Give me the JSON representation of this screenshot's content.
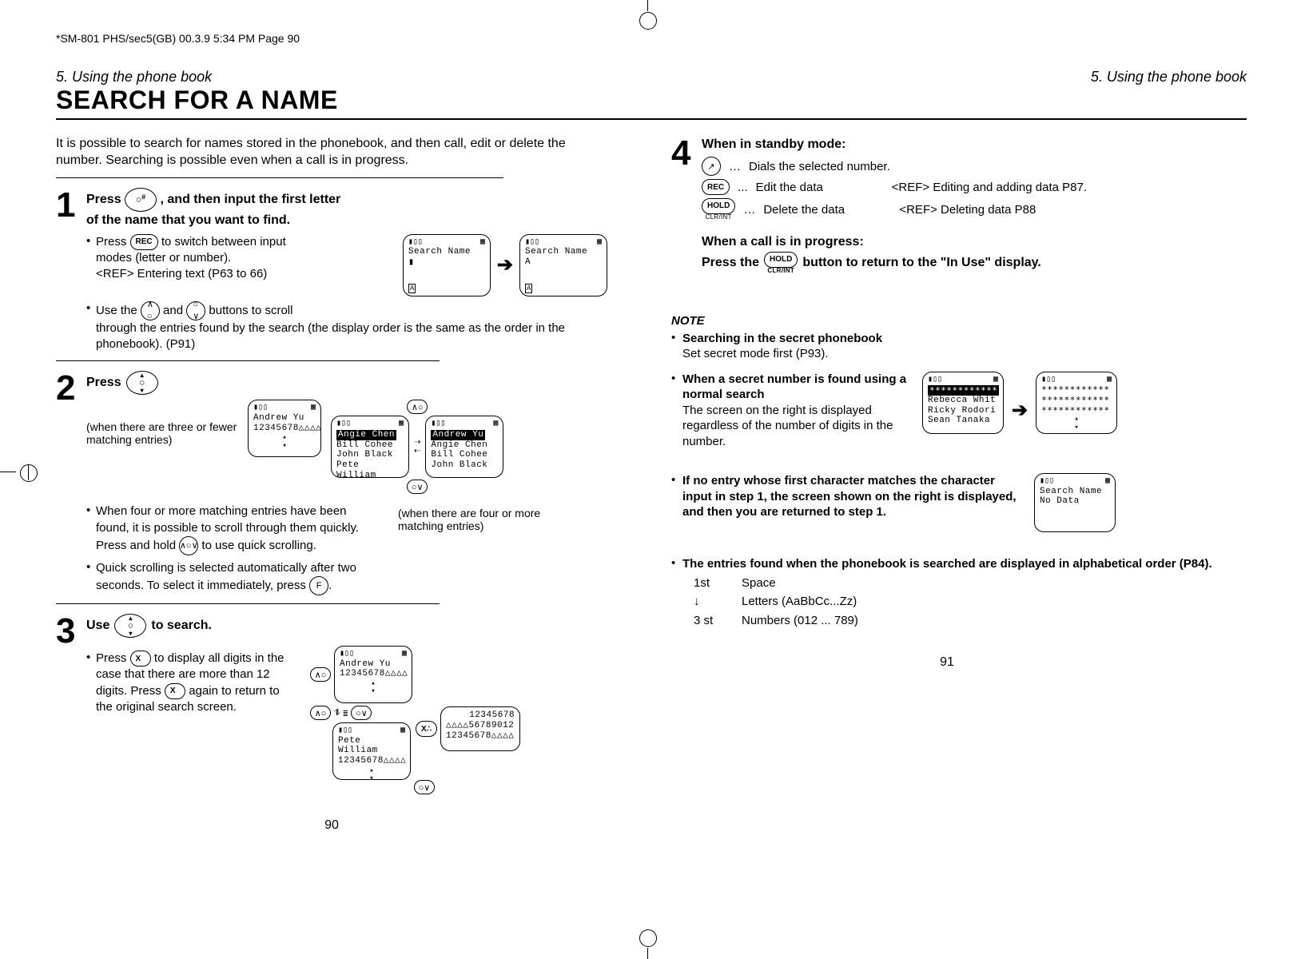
{
  "header_line": "*SM-801 PHS/sec5(GB)  00.3.9 5:34 PM  Page 90",
  "left": {
    "section": "5. Using the phone book",
    "title": "SEARCH FOR A NAME",
    "intro": "It is possible to search for names stored in the phonebook, and then call, edit or delete the number. Searching is possible even when a call is in progress.",
    "step1": {
      "lead1": "Press",
      "lead2": ", and then input the first letter",
      "lead3": "of the name that you want to find.",
      "b1a": "Press",
      "b1b": "to switch between input",
      "b1c": "modes (letter or number).",
      "ref1": "<REF> Entering text (P63 to 66)",
      "b2a": "Use the",
      "b2b": "and",
      "b2c": "buttons to scroll",
      "b2d": "through the entries found by the search (the display order is the same as the order in the phonebook). (P91)",
      "screen1_title": "Search Name",
      "screen1_mode": "A",
      "screen2_title": "Search Name",
      "screen2_line": "A",
      "screen2_mode": "A"
    },
    "step2": {
      "lead": "Press",
      "sub1": "(when there are three or fewer matching entries)",
      "screen_a_l1": "Andrew Yu",
      "screen_a_l2": "12345678△△△△",
      "list_l1": "Angie Chen",
      "list_l2": "Bill Cohee",
      "list_l3": "John Black",
      "list_l4": "Pete William",
      "list2_l1": "Andrew Yu",
      "list2_l2": "Angie Chen",
      "list2_l3": "Bill Cohee",
      "list2_l4": "John Black",
      "sub2": "(when there are four or more matching entries)",
      "b1": "When four or more matching entries have been found, it is possible to scroll through them quickly.",
      "b1a": "Press and hold",
      "b1b": "to use quick scrolling.",
      "b2": "Quick scrolling is selected automatically after two seconds. To select it immediately, press",
      "b2_end": "."
    },
    "step3": {
      "lead1": "Use",
      "lead2": "to search.",
      "b1a": "Press",
      "b1b": "to display all digits in the case that there are more than 12 digits. Press",
      "b1c": "again to return to the original search screen.",
      "screen_a_l1": "Andrew Yu",
      "screen_a_l2": "12345678△△△△",
      "screen_b_l1": "Pete William",
      "screen_b_l2": "12345678△△△△",
      "ext_l1": "12345678",
      "ext_l2": "△△△△56789012",
      "ext_l3": "12345678△△△△"
    },
    "pagenum": "90"
  },
  "right": {
    "section": "5. Using the phone book",
    "step4": {
      "head": "When in standby mode:",
      "row1": "Dials the selected number.",
      "row2a": "Edit the data",
      "row2b": "<REF> Editing and adding data P87.",
      "row3a": "Delete the data",
      "row3b": "<REF> Deleting data P88",
      "prog_head": "When a call is in progress:",
      "prog_a": "Press the",
      "prog_b": "button to return to the \"In Use\" display."
    },
    "note_title": "NOTE",
    "note1_h": "Searching in the secret phonebook",
    "note1_t": "Set secret mode first (P93).",
    "note2_h": "When a secret number is found using a normal search",
    "note2_t": "The screen on the right is displayed regardless of the number of digits in the number.",
    "note2_s1_l1": "∗∗∗∗∗∗∗∗∗∗∗∗",
    "note2_s1_l2": "Rebecca Whit",
    "note2_s1_l3": "Ricky Rodori",
    "note2_s1_l4": "Sean Tanaka",
    "note2_s2_l1": "∗∗∗∗∗∗∗∗∗∗∗∗",
    "note2_s2_l2": "∗∗∗∗∗∗∗∗∗∗∗∗",
    "note2_s2_l3": "∗∗∗∗∗∗∗∗∗∗∗∗",
    "note3": "If no entry whose first character matches the character input in step 1, the screen shown on the right is displayed, and then you are returned to step 1.",
    "note3_s_l1": "Search Name",
    "note3_s_l2": "No Data",
    "note4": "The entries found when the phonebook is searched are displayed in alphabetical order (P84).",
    "order": {
      "r1k": "1st",
      "r1v": "Space",
      "r2k": "↓",
      "r2v": "Letters (AaBbCc...Zz)",
      "r3k": "3 st",
      "r3v": "Numbers (012 ... 789)"
    },
    "pagenum": "91"
  }
}
